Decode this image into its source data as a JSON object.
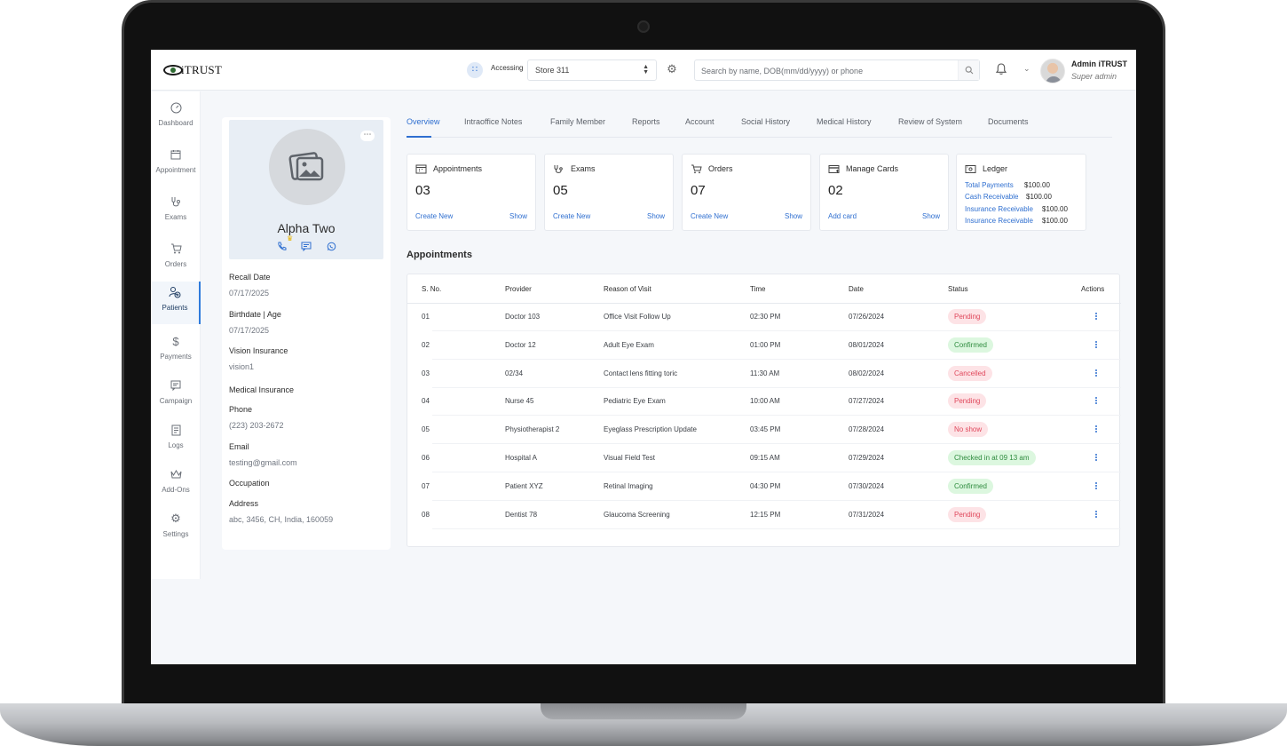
{
  "brand": {
    "logo_text": "iTRUST"
  },
  "topbar": {
    "accessing_label": "Accessing",
    "store_value": "Store 311",
    "search_placeholder": "Search by name, DOB(mm/dd/yyyy) or phone",
    "user_name": "Admin iTRUST",
    "user_role": "Super admin"
  },
  "nav": {
    "items": [
      {
        "label": "Dashboard",
        "icon": "gauge-icon"
      },
      {
        "label": "Appointment",
        "icon": "calendar-icon"
      },
      {
        "label": "Exams",
        "icon": "stethoscope-icon"
      },
      {
        "label": "Orders",
        "icon": "cart-icon"
      },
      {
        "label": "Patients",
        "icon": "patient-icon",
        "active": true
      },
      {
        "label": "Payments",
        "icon": "dollar-icon"
      },
      {
        "label": "Campaign",
        "icon": "message-icon"
      },
      {
        "label": "Logs",
        "icon": "document-icon"
      },
      {
        "label": "Add-Ons",
        "icon": "crown-icon"
      },
      {
        "label": "Settings",
        "icon": "gear-icon"
      }
    ]
  },
  "profile": {
    "name": "Alpha Two",
    "fields": [
      {
        "label": "Recall Date",
        "value": "07/17/2025"
      },
      {
        "label": "Birthdate | Age",
        "value": "07/17/2025"
      },
      {
        "label": "Vision Insurance",
        "value": "vision1"
      },
      {
        "label": "Medical Insurance",
        "value": ""
      },
      {
        "label": "Phone",
        "value": " (223) 203-2672"
      },
      {
        "label": "Email",
        "value": "testing@gmail.com"
      },
      {
        "label": "Occupation",
        "value": ""
      },
      {
        "label": "Address",
        "value": "abc, 3456, CH, India, 160059"
      }
    ]
  },
  "tabs": [
    "Overview",
    "Intraoffice Notes",
    "Family Member",
    "Reports",
    "Account",
    "Social History",
    "Medical History",
    "Review of System",
    "Documents"
  ],
  "active_tab": "Overview",
  "summary_cards": [
    {
      "title": "Appointments",
      "count": "03",
      "left_link": "Create New",
      "right_link": "Show",
      "icon": "calendar-icon"
    },
    {
      "title": "Exams",
      "count": "05",
      "left_link": "Create New",
      "right_link": "Show",
      "icon": "stethoscope-icon"
    },
    {
      "title": "Orders",
      "count": "07",
      "left_link": "Create New",
      "right_link": "Show",
      "icon": "cart-icon"
    },
    {
      "title": "Manage Cards",
      "count": "02",
      "left_link": "Add card",
      "right_link": "Show",
      "icon": "card-icon"
    }
  ],
  "ledger": {
    "title": "Ledger",
    "rows": [
      {
        "label": "Total Payments",
        "value": "$100.00"
      },
      {
        "label": "Cash Receivable",
        "value": "$100.00"
      },
      {
        "label": "Insurance Receivable",
        "value": "$100.00"
      },
      {
        "label": "Insurance Receivable",
        "value": "$100.00"
      }
    ]
  },
  "appointments": {
    "heading": "Appointments",
    "columns": [
      "S. No.",
      "Provider",
      "Reason of Visit",
      "Time",
      "Date",
      "Status",
      "Actions"
    ],
    "rows": [
      {
        "sno": "01",
        "provider": "Doctor 103",
        "reason": "Office Visit Follow Up",
        "time": "02:30 PM",
        "date": "07/26/2024",
        "status": "Pending"
      },
      {
        "sno": "02",
        "provider": "Doctor 12",
        "reason": "Adult Eye Exam",
        "time": "01:00 PM",
        "date": "08/01/2024",
        "status": "Confirmed"
      },
      {
        "sno": "03",
        "provider": "02/34",
        "reason": "Contact lens fitting toric",
        "time": "11:30 AM",
        "date": "08/02/2024",
        "status": "Cancelled"
      },
      {
        "sno": "04",
        "provider": "Nurse 45",
        "reason": "Pediatric Eye Exam",
        "time": "10:00 AM",
        "date": "07/27/2024",
        "status": "Pending"
      },
      {
        "sno": "05",
        "provider": "Physiotherapist 2",
        "reason": "Eyeglass Prescription Update",
        "time": "03:45 PM",
        "date": "07/28/2024",
        "status": "No show"
      },
      {
        "sno": "06",
        "provider": "Hospital A",
        "reason": "Visual Field Test",
        "time": "09:15 AM",
        "date": "07/29/2024",
        "status": "Checked in at 09 13 am"
      },
      {
        "sno": "07",
        "provider": "Patient XYZ",
        "reason": "Retinal Imaging",
        "time": "04:30 PM",
        "date": "07/30/2024",
        "status": "Confirmed"
      },
      {
        "sno": "08",
        "provider": "Dentist 78",
        "reason": "Glaucoma Screening",
        "time": "12:15 PM",
        "date": "07/31/2024",
        "status": "Pending"
      }
    ]
  },
  "status_colors": {
    "Pending": {
      "bg": "#fde3e6",
      "fg": "#e0485c"
    },
    "Cancelled": {
      "bg": "#fde3e6",
      "fg": "#e0485c"
    },
    "No show": {
      "bg": "#fde3e6",
      "fg": "#e0485c"
    },
    "Confirmed": {
      "bg": "#dcf7df",
      "fg": "#2e8b3e"
    },
    "Checked in at 09 13 am": {
      "bg": "#dcf7df",
      "fg": "#2e8b3e"
    }
  },
  "accent_color": "#2f6fd0"
}
